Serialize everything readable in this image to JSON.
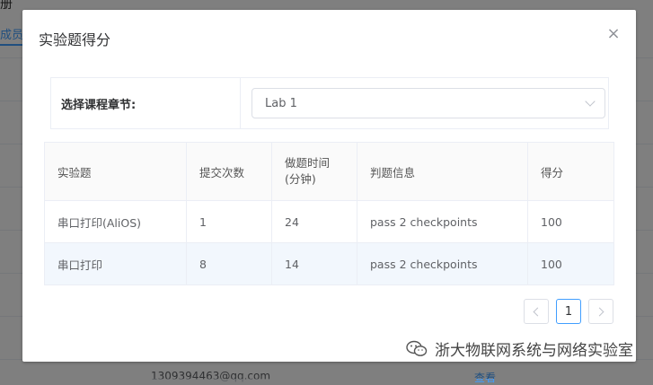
{
  "background": {
    "top_fragment": "册",
    "tab_fragment": "成员",
    "email_fragment": "1309394463@qq.com",
    "view_link": "查看"
  },
  "dialog": {
    "title": "实验题得分",
    "close_label": "×",
    "chapter_label": "选择课程章节:",
    "chapter_selected": "Lab 1"
  },
  "table": {
    "headers": [
      "实验题",
      "提交次数",
      "做题时间\n(分钟)",
      "判题信息",
      "得分"
    ],
    "rows": [
      [
        "串口打印(AliOS)",
        "1",
        "24",
        "pass 2 checkpoints",
        "100"
      ],
      [
        "串口打印",
        "8",
        "14",
        "pass 2 checkpoints",
        "100"
      ]
    ]
  },
  "pagination": {
    "current_page": "1"
  },
  "watermark": {
    "text": "浙大物联网系统与网络实验室"
  },
  "colors": {
    "accent": "#409eff",
    "highlight_row": "#f2f7fd"
  }
}
